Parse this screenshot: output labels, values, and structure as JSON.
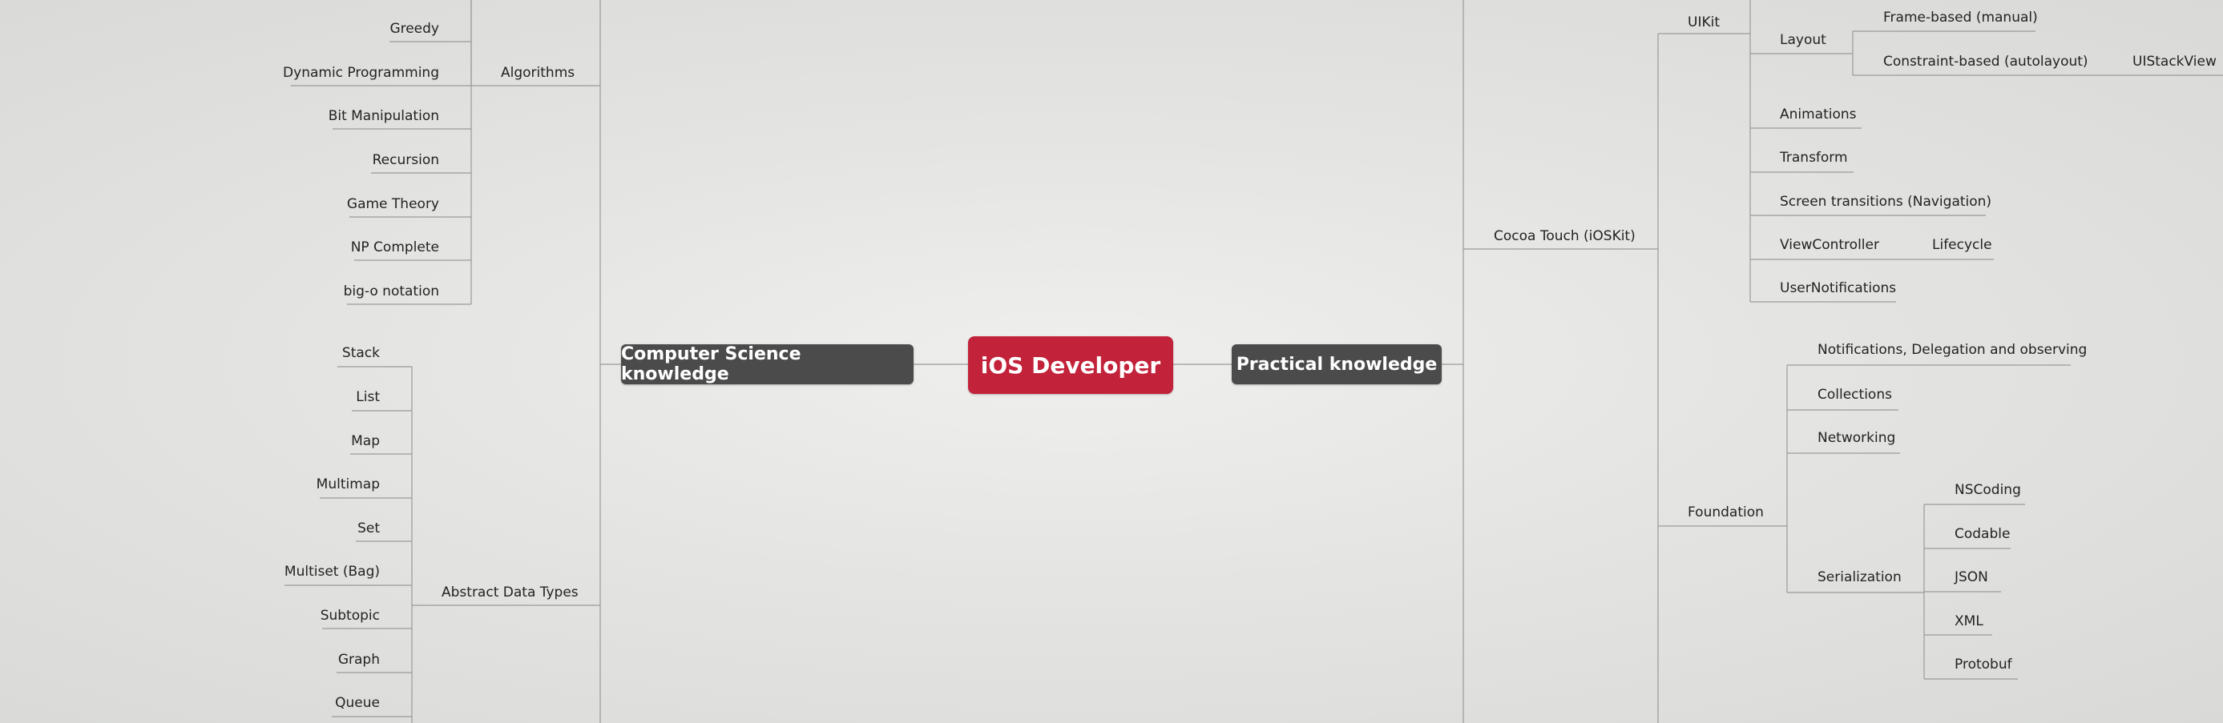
{
  "root": {
    "label": "iOS Developer"
  },
  "branches": {
    "computer_science": {
      "label": "Computer Science knowledge",
      "algorithms": {
        "label": "Algorithms",
        "items": [
          "Greedy",
          "Dynamic Programming",
          "Bit Manipulation",
          "Recursion",
          "Game Theory",
          "NP Complete",
          "big-o notation"
        ]
      },
      "abstract_data_types": {
        "label": "Abstract Data Types",
        "items": [
          "Stack",
          "List",
          "Map",
          "Multimap",
          "Set",
          "Multiset (Bag)",
          "Subtopic",
          "Graph",
          "Queue"
        ]
      }
    },
    "practical": {
      "label": "Practical knowledge",
      "cocoa_touch": {
        "label": "Cocoa Touch (iOSKit)",
        "uikit": {
          "label": "UIKit",
          "layout": {
            "label": "Layout",
            "frame_based": "Frame-based (manual)",
            "constraint_based": "Constraint-based (autolayout)",
            "uistackview": "UIStackView"
          },
          "animations": "Animations",
          "transform": "Transform",
          "screen_transitions": "Screen transitions (Navigation)",
          "viewcontroller": "ViewController",
          "lifecycle": "Lifecycle",
          "usernotifications": "UserNotifications"
        },
        "foundation": {
          "label": "Foundation",
          "notifications": "Notifications, Delegation and observing",
          "collections": "Collections",
          "networking": "Networking",
          "serialization": {
            "label": "Serialization",
            "items": [
              "NSCoding",
              "Codable",
              "JSON",
              "XML",
              "Protobuf"
            ]
          }
        }
      }
    }
  }
}
